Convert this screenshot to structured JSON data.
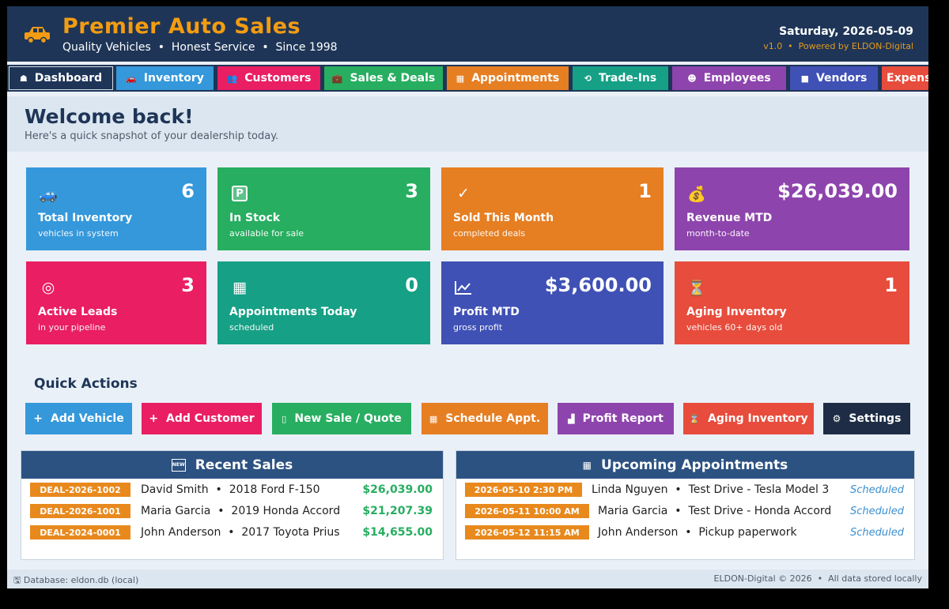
{
  "header": {
    "title": "Premier Auto Sales",
    "subtitle": "Quality Vehicles  •  Honest Service  •  Since 1998",
    "date": "Saturday, 2026-05-09",
    "version": "v1.0  •  Powered by ELDON-Digital",
    "logo_icon": "car-icon"
  },
  "nav": {
    "tabs": [
      {
        "label": "Dashboard",
        "icon": "home-icon",
        "color": "#1e3557"
      },
      {
        "label": "Inventory",
        "icon": "car-icon",
        "color": "#3498db"
      },
      {
        "label": "Customers",
        "icon": "users-icon",
        "color": "#e91e63"
      },
      {
        "label": "Sales & Deals",
        "icon": "briefcase-icon",
        "color": "#27ae60"
      },
      {
        "label": "Appointments",
        "icon": "calendar-icon",
        "color": "#e67e22"
      },
      {
        "label": "Trade-Ins",
        "icon": "exchange-icon",
        "color": "#16a085"
      },
      {
        "label": "Employees",
        "icon": "employees-icon",
        "color": "#8e44ad"
      },
      {
        "label": "Vendors",
        "icon": "store-icon",
        "color": "#3f51b5"
      },
      {
        "label": "Expenses",
        "icon": "money-icon",
        "color": "#e74c3c"
      }
    ]
  },
  "welcome": {
    "title": "Welcome back!",
    "subtitle": "Here's a quick snapshot of your dealership today."
  },
  "stats": [
    {
      "label": "Total Inventory",
      "sub": "vehicles in system",
      "value": "6",
      "icon": "car-icon",
      "color": "#3498db"
    },
    {
      "label": "In Stock",
      "sub": "available for sale",
      "value": "3",
      "icon": "parking-icon",
      "color": "#27ae60"
    },
    {
      "label": "Sold This Month",
      "sub": "completed deals",
      "value": "1",
      "icon": "check-icon",
      "color": "#e67e22"
    },
    {
      "label": "Revenue MTD",
      "sub": "month-to-date",
      "value": "$26,039.00",
      "icon": "money-bag-icon",
      "color": "#8e44ad"
    },
    {
      "label": "Active Leads",
      "sub": "in your pipeline",
      "value": "3",
      "icon": "target-icon",
      "color": "#e91e63"
    },
    {
      "label": "Appointments Today",
      "sub": "scheduled",
      "value": "0",
      "icon": "calendar-icon",
      "color": "#16a085"
    },
    {
      "label": "Profit MTD",
      "sub": "gross profit",
      "value": "$3,600.00",
      "icon": "chart-icon",
      "color": "#3f51b5"
    },
    {
      "label": "Aging Inventory",
      "sub": "vehicles 60+ days old",
      "value": "1",
      "icon": "hourglass-icon",
      "color": "#e74c3c"
    }
  ],
  "quick_actions": {
    "title": "Quick Actions",
    "buttons": [
      {
        "label": "Add Vehicle",
        "icon": "plus-icon",
        "color": "#3498db"
      },
      {
        "label": "Add Customer",
        "icon": "plus-icon",
        "color": "#e91e63"
      },
      {
        "label": "New Sale / Quote",
        "icon": "clipboard-icon",
        "color": "#27ae60"
      },
      {
        "label": "Schedule Appt.",
        "icon": "calendar-icon",
        "color": "#e67e22"
      },
      {
        "label": "Profit Report",
        "icon": "bar-chart-icon",
        "color": "#8e44ad"
      },
      {
        "label": "Aging Inventory",
        "icon": "hourglass-icon",
        "color": "#e74c3c"
      },
      {
        "label": "Settings",
        "icon": "gear-icon",
        "color": "#1e2d45"
      }
    ]
  },
  "recent_sales": {
    "title": "Recent Sales",
    "icon": "new-icon",
    "rows": [
      {
        "deal": "DEAL-2026-1002",
        "text": "David Smith  •  2018 Ford F-150",
        "amount": "$26,039.00"
      },
      {
        "deal": "DEAL-2026-1001",
        "text": "Maria Garcia  •  2019 Honda Accord",
        "amount": "$21,207.39"
      },
      {
        "deal": "DEAL-2024-0001",
        "text": "John Anderson  •  2017 Toyota Prius",
        "amount": "$14,655.00"
      }
    ]
  },
  "appointments": {
    "title": "Upcoming Appointments",
    "icon": "calendar-icon",
    "rows": [
      {
        "when": "2026-05-10 2:30 PM",
        "text": "Linda Nguyen  •  Test Drive - Tesla Model 3",
        "status": "Scheduled"
      },
      {
        "when": "2026-05-11 10:00 AM",
        "text": "Maria Garcia  •  Test Drive - Honda Accord",
        "status": "Scheduled"
      },
      {
        "when": "2026-05-12 11:15 AM",
        "text": "John Anderson  •  Pickup paperwork",
        "status": "Scheduled"
      }
    ]
  },
  "footer": {
    "left": "Database: eldon.db (local)",
    "right": "ELDON-Digital © 2026  •  All data stored locally",
    "icon": "disk-icon"
  }
}
